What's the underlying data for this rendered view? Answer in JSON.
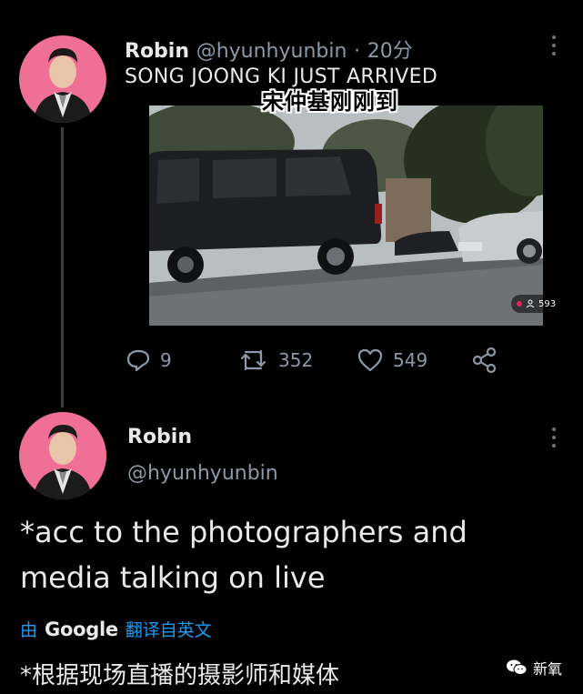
{
  "tweet": {
    "author_name": "Robin",
    "handle": "@hyunhyunbin",
    "separator": "·",
    "time": "20分",
    "text": "SONG JOONG KI JUST ARRIVED",
    "media_caption": "宋仲基刚刚到",
    "viewer_count": "593",
    "stats": {
      "replies": "9",
      "retweets": "352",
      "likes": "549"
    }
  },
  "reply": {
    "author_name": "Robin",
    "handle": "@hyunhyunbin",
    "body_line1": "*acc to the photographers and",
    "body_line2": "media talking on live",
    "translate_by": "由",
    "translate_provider": "Google",
    "translate_label": "翻译自英文",
    "translated_text": "*根据现场直播的摄影师和媒体"
  },
  "watermark": {
    "label": "新氧"
  },
  "colors": {
    "background": "#000000",
    "avatar_bg": "#f06f96",
    "link": "#1d9bf0",
    "muted": "#8b98a5"
  },
  "icons": [
    "more-icon",
    "reply-icon",
    "retweet-icon",
    "like-icon",
    "share-icon",
    "person-icon",
    "wechat-icon"
  ]
}
